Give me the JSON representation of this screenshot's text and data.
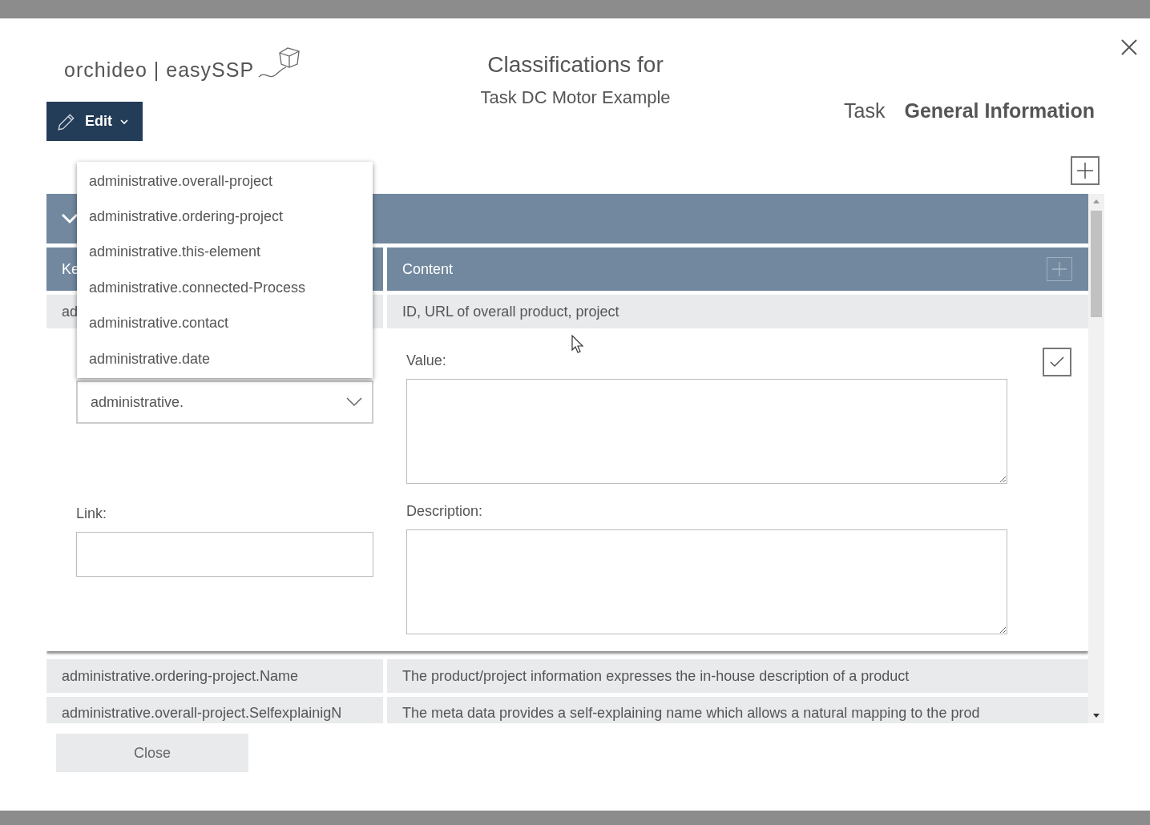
{
  "logo": {
    "text": "orchideo | easySSP"
  },
  "edit_button": {
    "label": "Edit"
  },
  "title": {
    "heading": "Classifications for",
    "subheading": "Task DC Motor Example"
  },
  "tabs": [
    {
      "label": "Task",
      "selected": false
    },
    {
      "label": "General Information",
      "selected": true
    }
  ],
  "table": {
    "group": {
      "expanded": true
    },
    "columns": [
      "Ke",
      "Content"
    ],
    "rows": [
      {
        "kind": "row",
        "key": "ad",
        "content": "ID, URL of overall product, project"
      },
      {
        "kind": "editor",
        "key_select": {
          "value": "administrative."
        },
        "value_label": "Value:",
        "link_label": "Link:",
        "description_label": "Description:"
      },
      {
        "kind": "row",
        "key": "administrative.ordering-project.Name",
        "content": "The product/project information expresses the in-house description of a product"
      },
      {
        "kind": "row",
        "key": "administrative.overall-project.SelfexplainigN",
        "content": "The meta data provides a self-explaining name which allows a natural mapping to the prod"
      }
    ]
  },
  "dropdown": {
    "options": [
      "administrative.overall-project",
      "administrative.ordering-project",
      "administrative.this-element",
      "administrative.connected-Process",
      "administrative.contact",
      "administrative.date"
    ]
  },
  "close_button": {
    "label": "Close"
  }
}
